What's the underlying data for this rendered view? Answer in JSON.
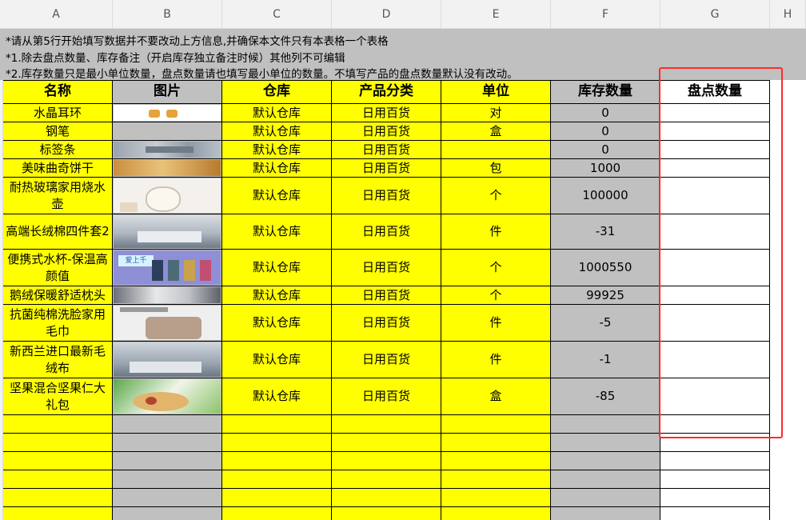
{
  "columns": [
    "A",
    "B",
    "C",
    "D",
    "E",
    "F",
    "G",
    "H"
  ],
  "notes": [
    "*请从第5行开始填写数据并不要改动上方信息,并确保本文件只有本表格一个表格",
    "*1.除去盘点数量、库存备注（开启库存独立备注时候）其他列不可编辑",
    "*2.库存数量只是最小单位数量，盘点数量请也填写最小单位的数量。不填写产品的盘点数量默认没有改动。"
  ],
  "headers": {
    "name": "名称",
    "image": "图片",
    "warehouse": "仓库",
    "category": "产品分类",
    "unit": "单位",
    "stock": "库存数量",
    "count": "盘点数量"
  },
  "rows": [
    {
      "name": "水晶耳环",
      "warehouse": "默认仓库",
      "category": "日用百货",
      "unit": "对",
      "stock": "0",
      "count": "",
      "thumb": "earring"
    },
    {
      "name": "钢笔",
      "warehouse": "默认仓库",
      "category": "日用百货",
      "unit": "盒",
      "stock": "0",
      "count": "",
      "thumb": "none"
    },
    {
      "name": "标签条",
      "warehouse": "默认仓库",
      "category": "日用百货",
      "unit": "",
      "stock": "0",
      "count": "",
      "thumb": "tags"
    },
    {
      "name": "美味曲奇饼干",
      "warehouse": "默认仓库",
      "category": "日用百货",
      "unit": "包",
      "stock": "1000",
      "count": "",
      "thumb": "cookie"
    },
    {
      "name": "耐热玻璃家用烧水壶",
      "warehouse": "默认仓库",
      "category": "日用百货",
      "unit": "个",
      "stock": "100000",
      "count": "",
      "thumb": "kettle"
    },
    {
      "name": "高端长绒棉四件套2",
      "warehouse": "默认仓库",
      "category": "日用百货",
      "unit": "件",
      "stock": "-31",
      "count": "",
      "thumb": "bedding"
    },
    {
      "name": "便携式水杯-保温高颜值",
      "warehouse": "默认仓库",
      "category": "日用百货",
      "unit": "个",
      "stock": "1000550",
      "count": "",
      "thumb": "cups"
    },
    {
      "name": "鹅绒保暖舒适枕头",
      "warehouse": "默认仓库",
      "category": "日用百货",
      "unit": "个",
      "stock": "99925",
      "count": "",
      "thumb": "pillow"
    },
    {
      "name": "抗菌纯棉洗脸家用毛巾",
      "warehouse": "默认仓库",
      "category": "日用百货",
      "unit": "件",
      "stock": "-5",
      "count": "",
      "thumb": "towel"
    },
    {
      "name": "新西兰进口最新毛绒布",
      "warehouse": "默认仓库",
      "category": "日用百货",
      "unit": "件",
      "stock": "-1",
      "count": "",
      "thumb": "bedroom"
    },
    {
      "name": "坚果混合坚果仁大礼包",
      "warehouse": "默认仓库",
      "category": "日用百货",
      "unit": "盒",
      "stock": "-85",
      "count": "",
      "thumb": "nuts"
    }
  ],
  "cup_label": "爱上千"
}
